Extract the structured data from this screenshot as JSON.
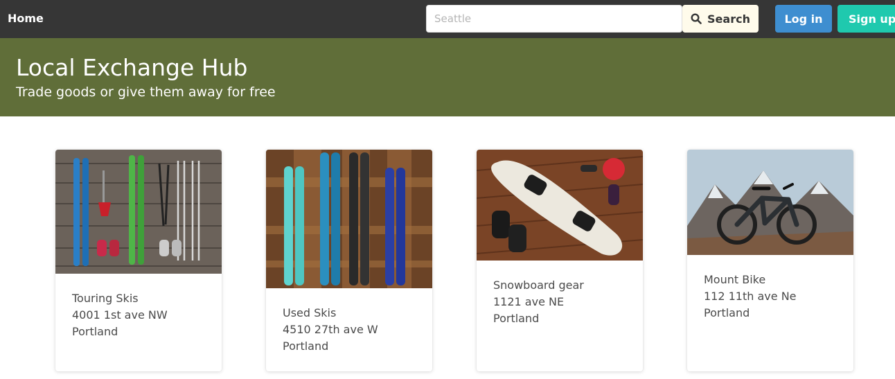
{
  "navbar": {
    "home_label": "Home",
    "search_placeholder": "Seattle",
    "search_value": "",
    "search_button_label": "Search",
    "login_label": "Log in",
    "signup_label": "Sign up"
  },
  "hero": {
    "title": "Local Exchange Hub",
    "subtitle": "Trade goods or give them away for free"
  },
  "listings": [
    {
      "title": "Touring Skis",
      "address": "4001 1st ave NW",
      "city": "Portland",
      "image_icon": "skis-photo"
    },
    {
      "title": "Used Skis",
      "address": "4510 27th ave W",
      "city": "Portland",
      "image_icon": "skis-photo"
    },
    {
      "title": "Snowboard gear",
      "address": "1121 ave NE",
      "city": "Portland",
      "image_icon": "snowboard-photo"
    },
    {
      "title": "Mount Bike",
      "address": "112 11th ave Ne",
      "city": "Portland",
      "image_icon": "mountain-bike-photo"
    }
  ],
  "colors": {
    "navbar": "#363636",
    "hero": "#606e39",
    "search_button": "#fffbeb",
    "login_button": "#3e8ed0",
    "signup_button": "#1fc9ae"
  }
}
